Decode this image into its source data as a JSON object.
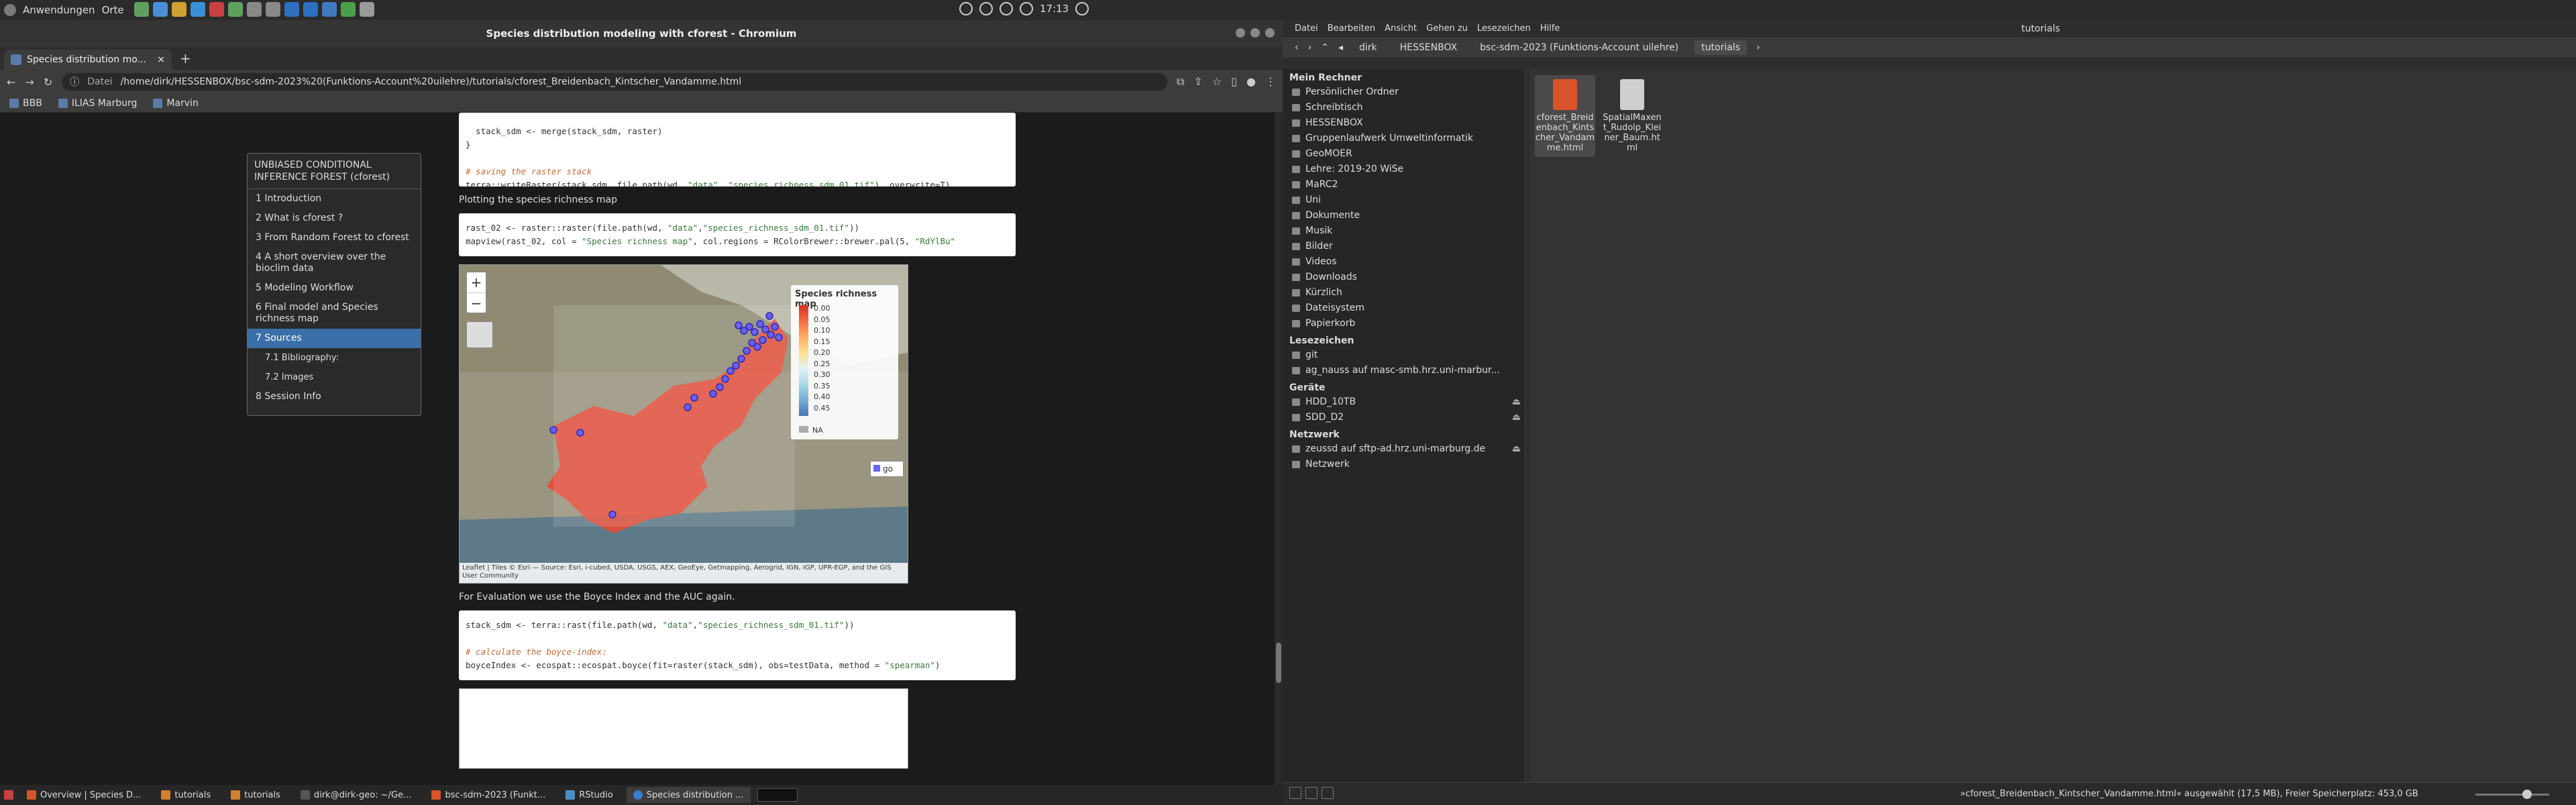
{
  "topbar": {
    "apps_label": "Anwendungen",
    "places_label": "Orte",
    "time": "17:13",
    "app_icons": [
      "#5fa05f",
      "#4a8fd6",
      "#d0a030",
      "#3a8fd6",
      "#c84040",
      "#5fa05f",
      "#888888",
      "#888888",
      "#2f6fc0",
      "#2f6fc0",
      "#3f78c0",
      "#4aa04a",
      "#9a9a9a"
    ]
  },
  "browser": {
    "window_title": "Species distribution modeling with cforest - Chromium",
    "tab_title": "Species distribution mo...",
    "url_label": "Datei",
    "url": "/home/dirk/HESSENBOX/bsc-sdm-2023%20(Funktions-Account%20uilehre)/tutorials/cforest_Breidenbach_Kintscher_Vandamme.html",
    "bookmarks": [
      "BBB",
      "ILIAS Marburg",
      "Marvin"
    ]
  },
  "toc": {
    "heading": "UNBIASED CONDITIONAL INFERENCE FOREST (cforest)",
    "items": [
      {
        "label": "1 Introduction"
      },
      {
        "label": "2 What is cforest ?"
      },
      {
        "label": "3 From Random Forest to cforest"
      },
      {
        "label": "4 A short overview over the bioclim data"
      },
      {
        "label": "5 Modeling Workflow"
      },
      {
        "label": "6 Final model and Species richness map"
      },
      {
        "label": "7 Sources"
      },
      {
        "label": "7.1 Bibliography:"
      },
      {
        "label": "7.2 Images"
      },
      {
        "label": "8 Session Info"
      }
    ]
  },
  "content": {
    "code1": {
      "l1": "  stack_sdm <- merge(stack_sdm, raster)",
      "l2": "}",
      "l3_comment": "# saving the raster stack",
      "l4a": "terra::writeRaster(stack_sdm, file.path(wd, ",
      "l4_str1": "\"data\"",
      "l4b": ", ",
      "l4_str2": "\"species_richness_sdm_01.tif\"",
      "l4c": "), overwrite=T)"
    },
    "para1": "Plotting the species richness map",
    "code2": {
      "l1a": "rast_02 <- raster::raster(file.path(wd, ",
      "l1_str1": "\"data\"",
      "l1b": ",",
      "l1_str2": "\"species_richness_sdm_01.tif\"",
      "l1c": "))",
      "l2a": "mapview(rast_02, col = ",
      "l2_str1": "\"Species richness map\"",
      "l2b": ", col.regions = RColorBrewer::brewer.pal(5, ",
      "l2_str2": "\"RdYlBu\""
    },
    "map": {
      "zoom_in": "+",
      "zoom_out": "−",
      "legend_title": "Species richness map",
      "legend_ticks": [
        "0.00",
        "0.05",
        "0.10",
        "0.15",
        "0.20",
        "0.25",
        "0.30",
        "0.35",
        "0.40",
        "0.45"
      ],
      "legend_na": "NA",
      "go_label": "go",
      "attribution": "Leaflet | Tiles © Esri — Source: Esri, i-cubed, USDA, USGS, AEX, GeoEye, Getmapping, Aerogrid, IGN, IGP, UPR-EGP, and the GIS User Community"
    },
    "para2": "For Evaluation we use the Boyce Index and the AUC again.",
    "code3": {
      "l1a": "stack_sdm <- terra::rast(file.path(wd, ",
      "l1_str1": "\"data\"",
      "l1b": ",",
      "l1_str2": "\"species_richness_sdm_01.tif\"",
      "l1c": "))",
      "l2": "",
      "l3_comment": "# calculate the boyce-index:",
      "l4a": "boyceIndex <- ecospat::ecospat.boyce(fit=raster(stack_sdm), obs=testData, method = ",
      "l4_str": "\"spearman\"",
      "l4b": ")"
    }
  },
  "filemanager": {
    "menu": [
      "Datei",
      "Bearbeiten",
      "Ansicht",
      "Gehen zu",
      "Lesezeichen",
      "Hilfe"
    ],
    "window_title": "tutorials",
    "breadcrumbs": [
      "dirk",
      "HESSENBOX",
      "bsc-sdm-2023 (Funktions-Account uilehre)",
      "tutorials"
    ],
    "sections": {
      "mein_rechner": "Mein Rechner",
      "lesezeichen": "Lesezeichen",
      "geraete": "Geräte",
      "netzwerk": "Netzwerk"
    },
    "mein_rechner_items": [
      "Persönlicher Ordner",
      "Schreibtisch",
      "HESSENBOX",
      "Gruppenlaufwerk Umweltinformatik",
      "GeoMOER",
      "Lehre: 2019-20 WiSe",
      "MaRC2",
      "Uni",
      "Dokumente",
      "Musik",
      "Bilder",
      "Videos",
      "Downloads",
      "Kürzlich",
      "Dateisystem",
      "Papierkorb"
    ],
    "lesezeichen_items": [
      "git",
      "ag_nauss auf masc-smb.hrz.uni-marbur..."
    ],
    "geraete_items": [
      "HDD_10TB",
      "SDD_D2"
    ],
    "netzwerk_items": [
      "zeussd auf sftp-ad.hrz.uni-marburg.de",
      "Netzwerk"
    ],
    "files": [
      {
        "name": "cforest_Breidenbach_Kintscher_Vandamme.html",
        "color": "#d9532b"
      },
      {
        "name": "SpatialMaxent_Rudolp_Kleiner_Baum.html",
        "color": "#cfcfcf"
      }
    ],
    "status": "»cforest_Breidenbach_Kintscher_Vandamme.html« ausgewählt (17,5 MB), Freier Speicherplatz: 453,0 GB"
  },
  "taskbar": {
    "items": [
      "Overview | Species D...",
      "tutorials",
      "tutorials",
      "dirk@dirk-geo: ~/Ge...",
      "bsc-sdm-2023 (Funkt...",
      "RStudio",
      "Species distribution ..."
    ]
  }
}
